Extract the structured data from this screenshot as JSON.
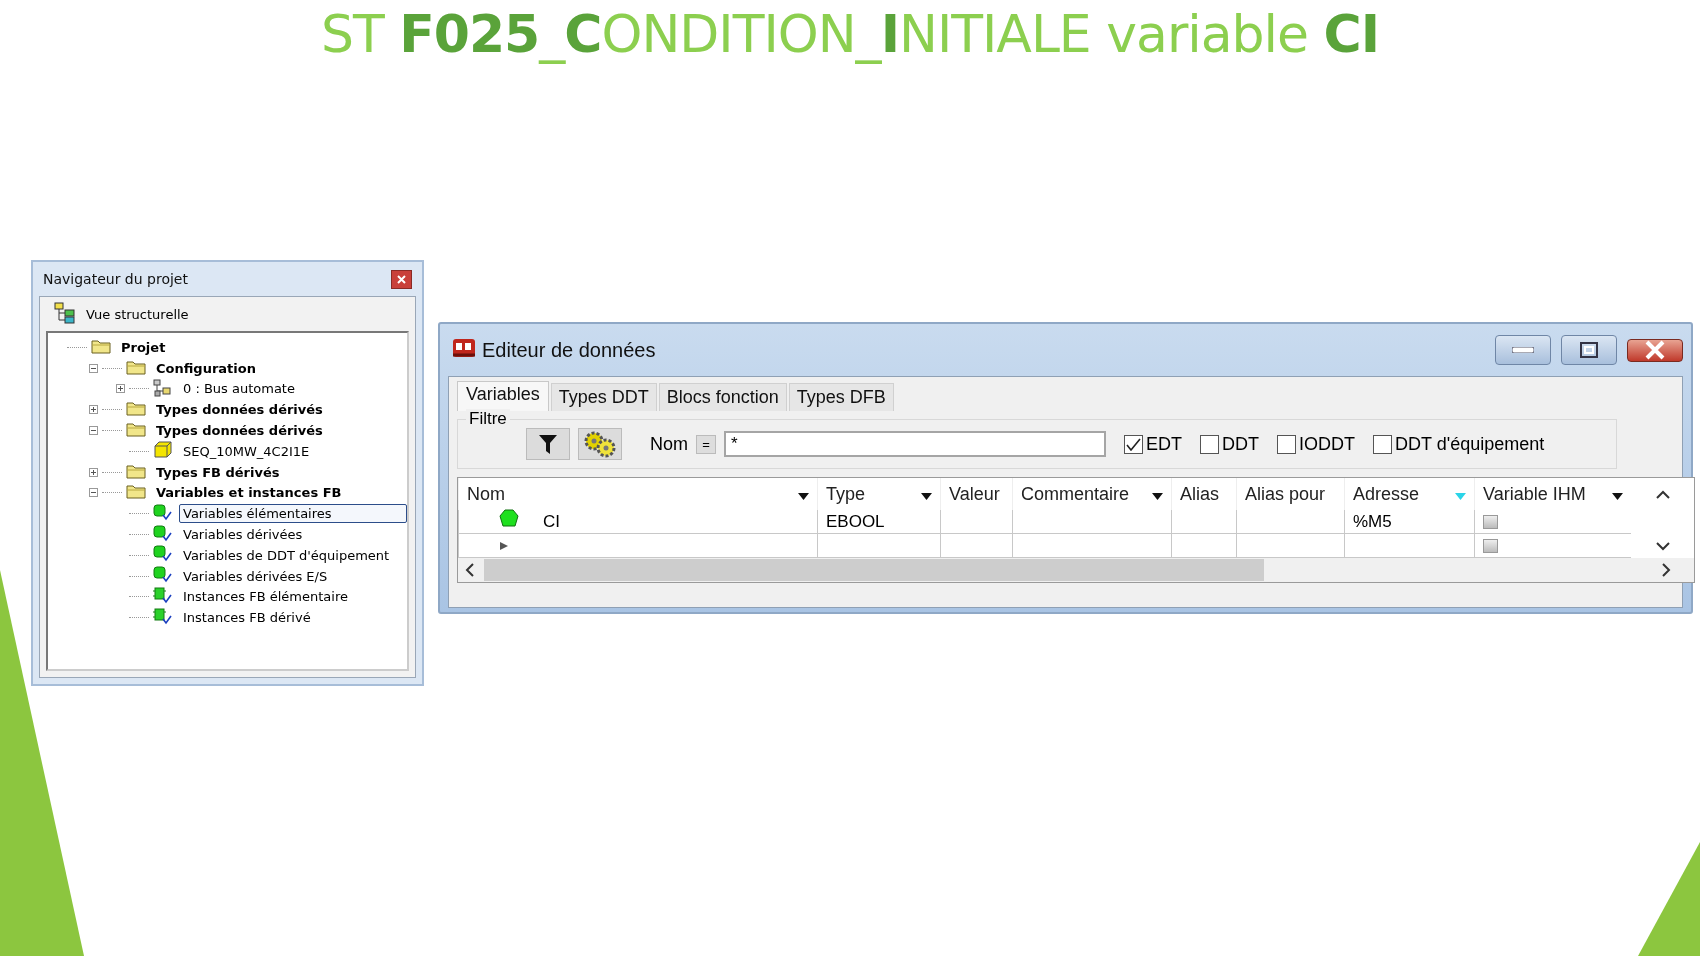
{
  "title": "ST **F025**_**C**ONDITION_**I**NITIALE variable **CI**",
  "navigator": {
    "title": "Navigateur du projet",
    "view": "Vue structurelle",
    "tree": [
      {
        "label": "Projet",
        "kind": "folder",
        "children": [
          {
            "label": "Configuration",
            "kind": "folder",
            "expanded": true,
            "children": [
              {
                "label": "0 : Bus automate",
                "kind": "bus",
                "expanded": false,
                "selected": false
              }
            ],
            "selected": false
          },
          {
            "label": "Types données dérivés",
            "kind": "folder",
            "expanded": false,
            "selected": false
          },
          {
            "label": "Types données dérivés",
            "kind": "folder",
            "expanded": true,
            "children": [
              {
                "label": "SEQ_10MW_4C2I1E",
                "kind": "ddt",
                "selected": false
              }
            ],
            "selected": false
          },
          {
            "label": "Types FB dérivés",
            "kind": "folder",
            "expanded": false,
            "selected": false
          },
          {
            "label": "Variables et instances FB",
            "kind": "folder",
            "expanded": true,
            "selected": false,
            "children": [
              {
                "label": "Variables élémentaires",
                "kind": "var",
                "selected": true
              },
              {
                "label": "Variables dérivées",
                "kind": "var",
                "selected": false
              },
              {
                "label": "Variables de DDT d'équipement",
                "kind": "var",
                "selected": false
              },
              {
                "label": "Variables dérivées E/S",
                "kind": "var",
                "selected": false
              },
              {
                "label": "Instances FB élémentaire",
                "kind": "fb",
                "selected": false
              },
              {
                "label": "Instances FB dérivé",
                "kind": "fb",
                "selected": false
              }
            ]
          }
        ],
        "selected": false
      }
    ]
  },
  "editor": {
    "title": "Editeur de données",
    "tabs": [
      {
        "label": "Variables",
        "selected": true
      },
      {
        "label": "Types DDT",
        "selected": false
      },
      {
        "label": "Blocs fonction",
        "selected": false
      },
      {
        "label": "Types DFB",
        "selected": false
      }
    ],
    "filter": {
      "legend": "Filtre",
      "name_label": "Nom",
      "operator": "=",
      "value": "*",
      "types": [
        {
          "label": "EDT",
          "checked": true
        },
        {
          "label": "DDT",
          "checked": false
        },
        {
          "label": "IODDT",
          "checked": false
        },
        {
          "label": "DDT d'équipement",
          "checked": false
        }
      ]
    },
    "table": {
      "columns": [
        {
          "label": "Nom",
          "has_menu": true,
          "sorted": false
        },
        {
          "label": "Type",
          "has_menu": true,
          "sorted": false
        },
        {
          "label": "Valeur",
          "has_menu": false,
          "sorted": false
        },
        {
          "label": "Commentaire",
          "has_menu": true,
          "sorted": false
        },
        {
          "label": "Alias",
          "has_menu": false,
          "sorted": false
        },
        {
          "label": "Alias pour",
          "has_menu": false,
          "sorted": false
        },
        {
          "label": "Adresse",
          "has_menu": true,
          "sorted": true
        },
        {
          "label": "Variable IHM",
          "has_menu": true,
          "sorted": false
        }
      ],
      "rows": [
        {
          "kind": "variable",
          "cells": [
            "CI",
            "EBOOL",
            "",
            "",
            "",
            "",
            "%M5"
          ],
          "hmi": false
        },
        {
          "kind": "new",
          "cells": [
            "",
            "",
            "",
            "",
            "",
            "",
            ""
          ],
          "hmi": false
        }
      ]
    }
  }
}
